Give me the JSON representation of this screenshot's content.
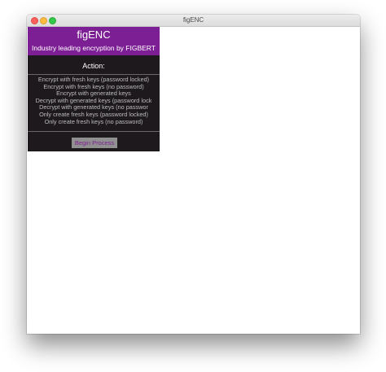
{
  "window": {
    "title": "figENC"
  },
  "app": {
    "title": "figENC",
    "subtitle": "Industry leading encryption by FIGBERT",
    "action_label": "Action:",
    "options": [
      "Encrypt with fresh keys (password locked)",
      "Encrypt with fresh keys (no password)",
      "Encrypt with generated keys",
      "Decrypt with generated keys (password lock",
      "Decrypt with generated keys (no passwor",
      "Only create fresh keys (password locked)",
      "Only create fresh keys (no password)"
    ],
    "begin_button": "Begin Process"
  },
  "colors": {
    "accent": "#7d1f94",
    "panel_bg": "#1d191d",
    "option_text": "#bdbdbd",
    "button_bg": "#909090"
  }
}
